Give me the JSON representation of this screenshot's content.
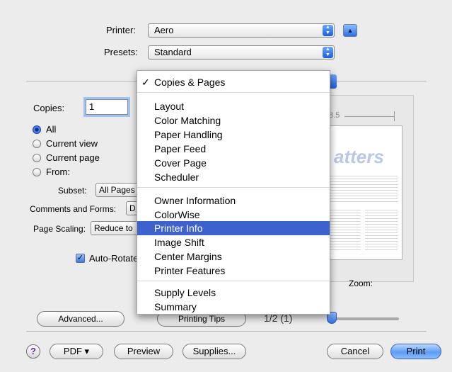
{
  "printer": {
    "label": "Printer:",
    "value": "Aero"
  },
  "presets": {
    "label": "Presets:",
    "value": "Standard"
  },
  "copies": {
    "label": "Copies:",
    "value": "1"
  },
  "pages": {
    "all": "All",
    "current_view": "Current view",
    "current_page": "Current page",
    "from": "From:",
    "selected": "all"
  },
  "subset": {
    "label": "Subset:",
    "value": "All Pages"
  },
  "comments": {
    "label": "Comments and Forms:",
    "value": "D"
  },
  "scaling": {
    "label": "Page Scaling:",
    "value": "Reduce to"
  },
  "auto_rotate": {
    "label": "Auto-Rotate",
    "checked": true
  },
  "advanced_button": "Advanced...",
  "printing_tips_button": "Printing Tips",
  "page_counter": "1/2 (1)",
  "preview": {
    "ruler_label": "8.5",
    "brand_text": "atters",
    "zoom_label": "Zoom:"
  },
  "bottom": {
    "help": "?",
    "pdf": "PDF ▾",
    "preview": "Preview",
    "supplies": "Supplies...",
    "cancel": "Cancel",
    "print": "Print"
  },
  "menu": {
    "checked_item": "Copies & Pages",
    "group1": [
      "Layout",
      "Color Matching",
      "Paper Handling",
      "Paper Feed",
      "Cover Page",
      "Scheduler"
    ],
    "group2": [
      "Owner Information",
      "ColorWise",
      "Printer Info",
      "Image Shift",
      "Center Margins",
      "Printer Features"
    ],
    "group3": [
      "Supply Levels",
      "Summary"
    ],
    "highlighted": "Printer Info"
  },
  "colors": {
    "accent": "#3d62ce",
    "default_button": "#5d9cf5"
  }
}
